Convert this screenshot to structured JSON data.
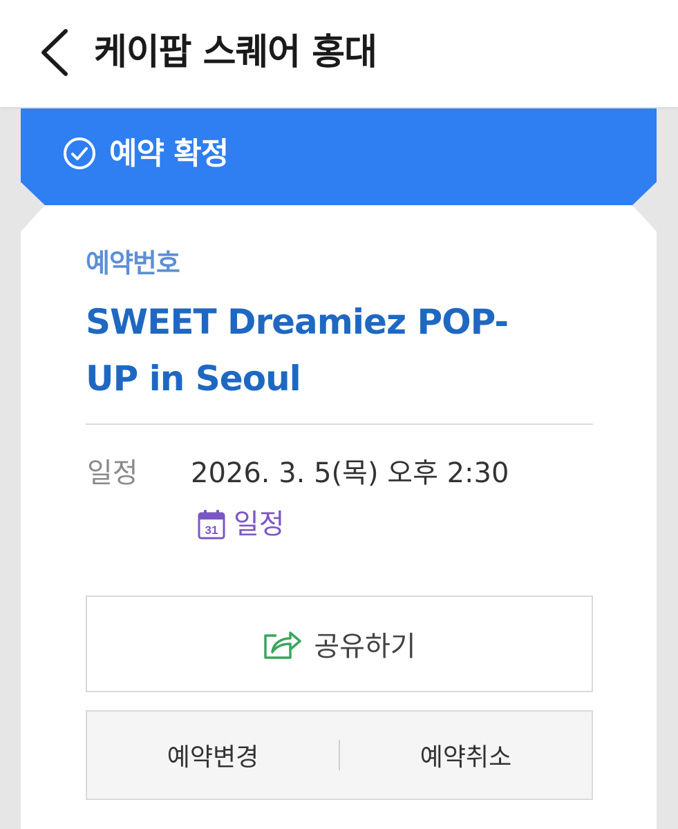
{
  "header": {
    "title": "케이팝 스퀘어 홍대",
    "back_icon": "chevron-left-icon"
  },
  "status_banner": {
    "text": "예약 확정",
    "icon": "check-circle-icon",
    "color": "#2f7ef2"
  },
  "reservation": {
    "label": "예약번호",
    "title": "SWEET Dreamiez POP-UP in Seoul"
  },
  "schedule": {
    "label": "일정",
    "value": "2026. 3. 5(목) 오후 2:30",
    "calendar_link": {
      "icon": "calendar-icon",
      "icon_text": "31",
      "label": "일정"
    }
  },
  "share": {
    "icon": "share-icon",
    "label": "공유하기"
  },
  "actions": {
    "change_label": "예약변경",
    "cancel_label": "예약취소"
  },
  "colors": {
    "accent_blue": "#2f7ef2",
    "title_blue": "#1f68c2",
    "label_blue": "#5d8fd6",
    "calendar_purple": "#7b57c6",
    "share_green": "#3aa55d"
  }
}
